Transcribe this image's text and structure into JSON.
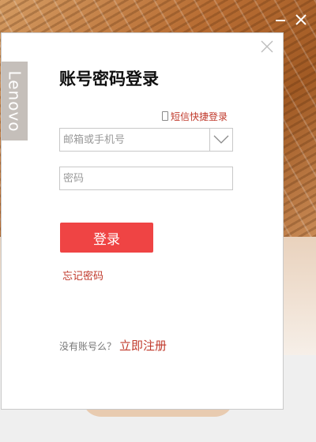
{
  "window": {
    "minimize_icon": "minimize-icon",
    "close_icon": "close-icon"
  },
  "brand": {
    "name": "Lenovo",
    "color": "#c5bfba"
  },
  "dialog": {
    "title": "账号密码登录",
    "sms_login_label": "短信快捷登录",
    "account_placeholder": "邮箱或手机号",
    "account_value": "",
    "password_placeholder": "密码",
    "password_value": "",
    "login_label": "登录",
    "forgot_label": "忘记密码",
    "register_prompt": "没有账号么？",
    "register_label": "立即注册",
    "close_glyph": "×"
  },
  "colors": {
    "accent": "#ef4444",
    "link": "#c0392b"
  }
}
